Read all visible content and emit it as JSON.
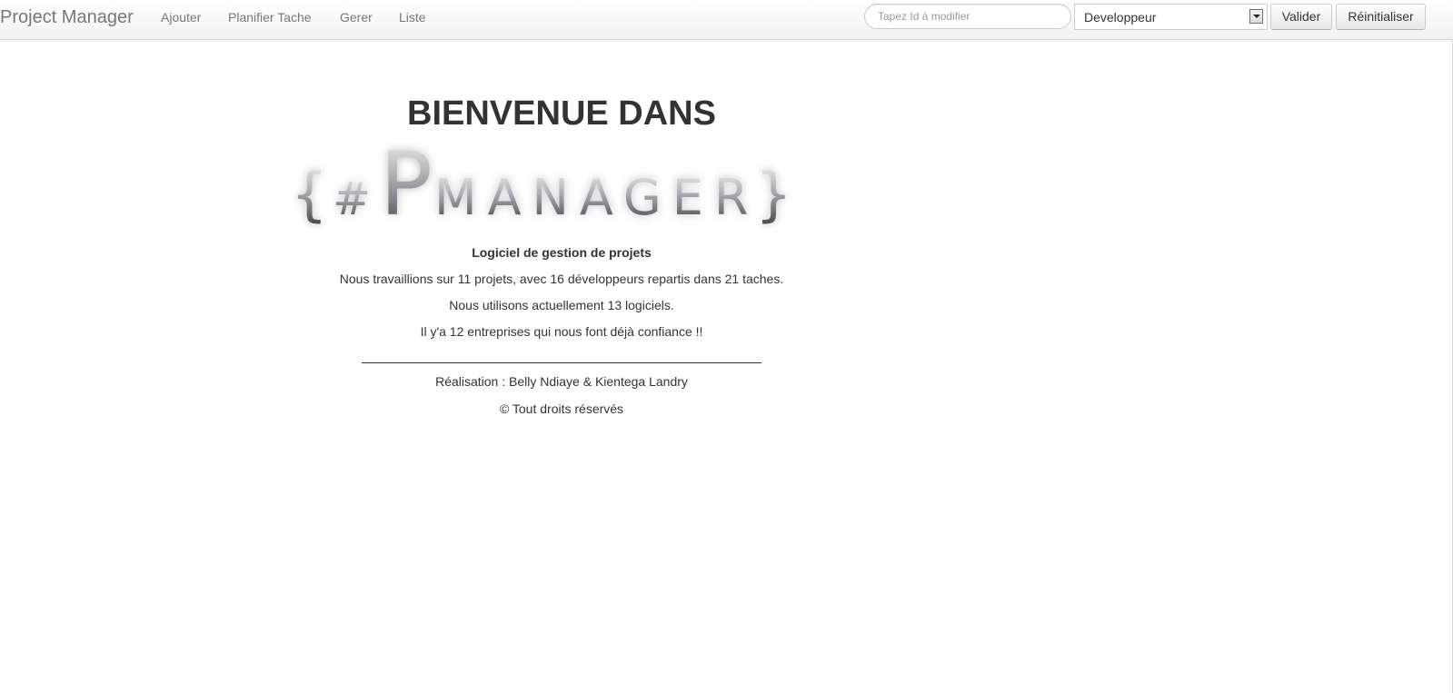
{
  "navbar": {
    "brand": "Project Manager",
    "links": [
      "Ajouter",
      "Planifier Tache",
      "Gerer",
      "Liste"
    ],
    "search_placeholder": "Tapez Id à modifier",
    "role_select_value": "Developpeur",
    "validate_label": "Valider",
    "reset_label": "Réinitialiser"
  },
  "main": {
    "title": "BIENVENUE DANS",
    "logo_text": "{ #PMANAGER }",
    "subtitle": "Logiciel de gestion de projets",
    "paragraphs": [
      "Nous travaillions sur 11 projets, avec 16 développeurs repartis dans 21 taches.",
      "Nous utilisons actuellement 13 logiciels.",
      "Il y'a 12 entreprises qui nous font déjà confiance !!"
    ],
    "credits": "Réalisation : Belly Ndiaye & Kientega Landry",
    "copyright": "© Tout droits réservés"
  },
  "colors": {
    "nav_text": "#777777",
    "body_text": "#333333",
    "border": "#cccccc"
  }
}
